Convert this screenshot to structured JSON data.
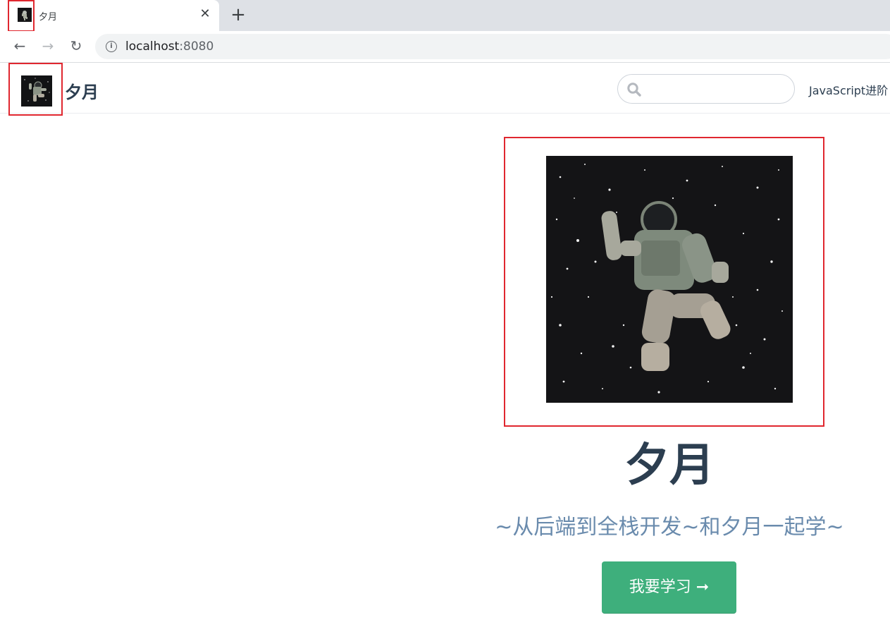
{
  "browser": {
    "tab": {
      "title": "夕月",
      "close_glyph": "✕"
    },
    "new_tab_glyph": "+",
    "nav": {
      "back": "←",
      "forward": "→",
      "reload": "↻"
    },
    "address": {
      "host": "localhost",
      "port": ":8080",
      "info_glyph": "i"
    }
  },
  "navbar": {
    "site_name": "夕月",
    "search": {
      "value": "",
      "placeholder": ""
    },
    "links": [
      {
        "label": "JavaScript进阶"
      }
    ]
  },
  "hero": {
    "title": "夕月",
    "description": "~从后端到全栈开发~和夕月一起学~",
    "action_label": "我要学习 ➞"
  },
  "colors": {
    "accent": "#3eaf7c",
    "text": "#2c3e50",
    "description": "#6a8bad",
    "highlight_box": "#e0272f"
  },
  "icons": {
    "favicon": "astronaut-icon",
    "logo": "astronaut-logo",
    "search": "search-icon",
    "hero_image": "astronaut-image"
  }
}
